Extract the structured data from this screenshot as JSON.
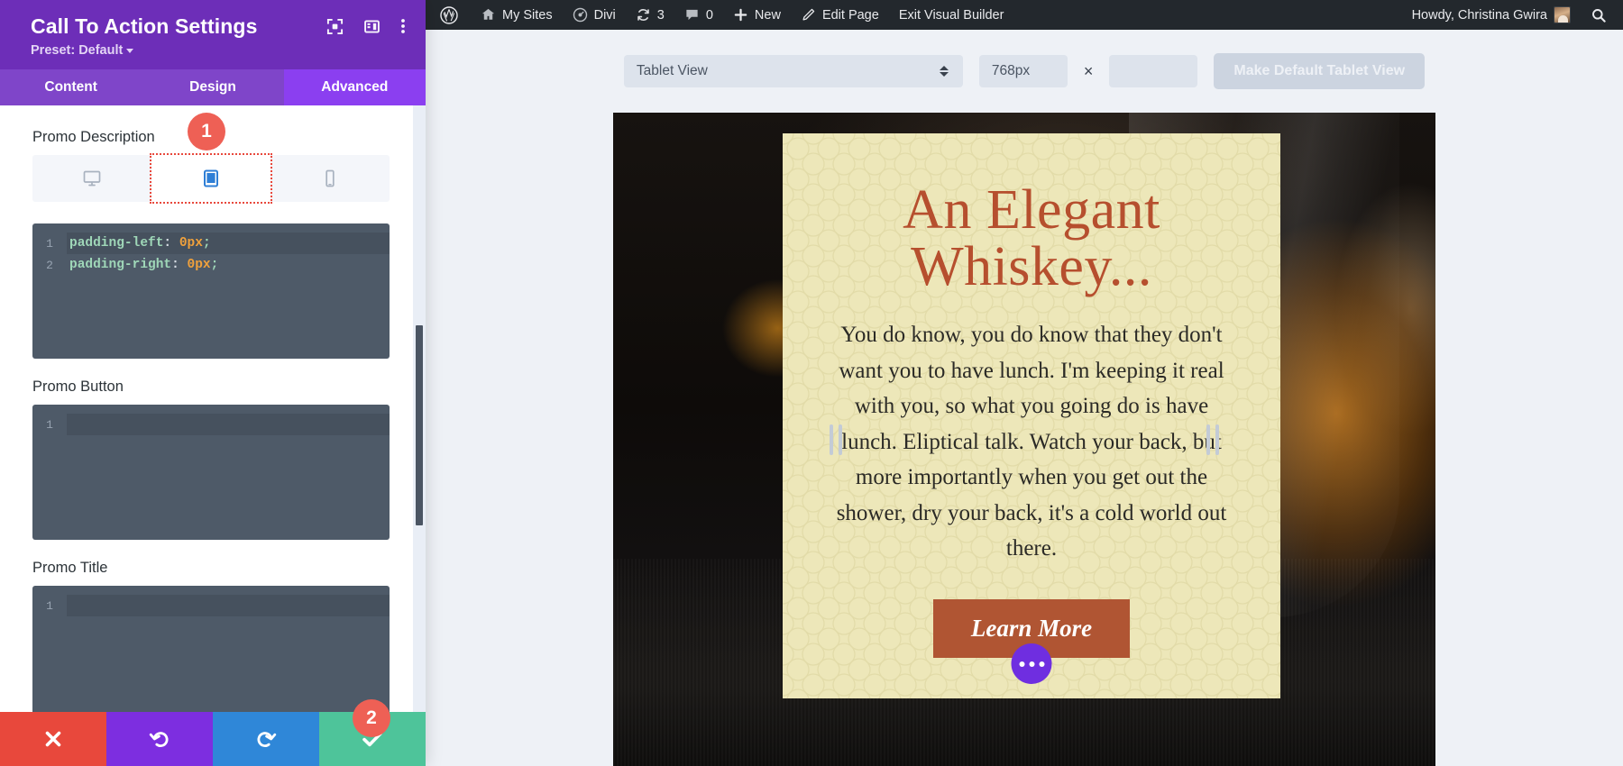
{
  "adminbar": {
    "items": [
      {
        "id": "wp-logo",
        "icon": "wordpress-icon",
        "label": ""
      },
      {
        "id": "my-sites",
        "icon": "sites-icon",
        "label": "My Sites"
      },
      {
        "id": "divi",
        "icon": "divi-icon",
        "label": "Divi"
      },
      {
        "id": "updates",
        "icon": "updates-icon",
        "label": "3"
      },
      {
        "id": "comments",
        "icon": "comment-icon",
        "label": "0"
      },
      {
        "id": "new",
        "icon": "plus-icon",
        "label": "New"
      },
      {
        "id": "edit-page",
        "icon": "pencil-icon",
        "label": "Edit Page"
      },
      {
        "id": "exit-visual-builder",
        "icon": "",
        "label": "Exit Visual Builder"
      }
    ],
    "account_greeting": "Howdy, Christina Gwira",
    "search_icon": "search-icon"
  },
  "settings_panel": {
    "title": "Call To Action Settings",
    "preset_label": "Preset: Default",
    "header_icons": [
      {
        "name": "focus-target-icon"
      },
      {
        "name": "layout-columns-icon"
      },
      {
        "name": "kebab-menu-icon"
      }
    ],
    "tabs": [
      {
        "label": "Content",
        "active": false
      },
      {
        "label": "Design",
        "active": false
      },
      {
        "label": "Advanced",
        "active": true
      }
    ],
    "fields": [
      {
        "label": "Promo Description",
        "devices": [
          {
            "name": "desktop-icon",
            "active": false
          },
          {
            "name": "tablet-icon",
            "active": true
          },
          {
            "name": "phone-icon",
            "active": false
          }
        ],
        "code_lines": [
          {
            "num": "1",
            "prop": "padding-left",
            "colon": ":",
            "value": "0px",
            "semi": ";",
            "active": true
          },
          {
            "num": "2",
            "prop": "padding-right",
            "colon": ":",
            "value": "0px",
            "semi": ";",
            "active": false
          }
        ]
      },
      {
        "label": "Promo Button",
        "code_lines": [
          {
            "num": "1",
            "prop": "",
            "colon": "",
            "value": "",
            "semi": "",
            "active": true
          }
        ]
      },
      {
        "label": "Promo Title",
        "code_lines": [
          {
            "num": "1",
            "prop": "",
            "colon": "",
            "value": "",
            "semi": "",
            "active": true
          }
        ]
      }
    ],
    "actions": [
      {
        "name": "cancel-button",
        "icon": "close-x-icon",
        "color": "#e8483c"
      },
      {
        "name": "undo-button",
        "icon": "undo-arrow-icon",
        "color": "#7d2ee0"
      },
      {
        "name": "redo-button",
        "icon": "redo-arrow-icon",
        "color": "#2f87d8"
      },
      {
        "name": "save-button",
        "icon": "checkmark-icon",
        "color": "#4ec49a"
      }
    ]
  },
  "annotations": [
    {
      "number": "1"
    },
    {
      "number": "2"
    }
  ],
  "responsive_toolbar": {
    "view_select_value": "Tablet View",
    "width_value": "768px",
    "separator": "×",
    "height_value": "",
    "height_placeholder": "",
    "make_default_label": "Make Default Tablet View"
  },
  "preview": {
    "cta_title": "An Elegant\nWhiskey...",
    "cta_description": "You do know, you do know that they don't want you to have lunch. I'm keeping it real with you, so what you going do is have lunch. Eliptical talk. Watch your back, but more importantly when you get out the shower, dry your back, it's a cold world out there.",
    "cta_button_label": "Learn More",
    "module_settings_icon": "ellipsis-icon",
    "handle_left": "resize-handle-left",
    "handle_right": "resize-handle-right"
  },
  "colors": {
    "panel_purple": "#6d2eb8",
    "tab_active_purple": "#8b3ff0",
    "badge_red": "#ee6055",
    "cta_bg": "#ede7b9",
    "cta_title": "#b64f2e",
    "cta_button_bg": "#b05533",
    "save_green": "#4ec49a",
    "cancel_red": "#e8483c",
    "editor_bg": "#4e5a68"
  }
}
